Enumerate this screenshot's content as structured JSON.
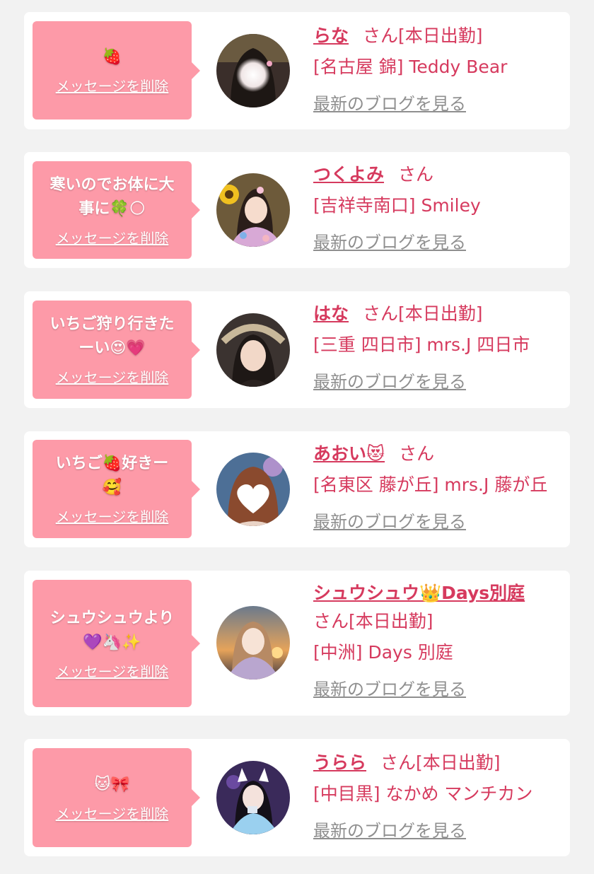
{
  "items": [
    {
      "message": "🍓",
      "delete_label": "メッセージを削除",
      "name": "らな",
      "suffix": "さん[本日出勤]",
      "shop": "[名古屋 錦] Teddy Bear",
      "blog_label": "最新のブログを見る"
    },
    {
      "message": "寒いのでお体に大\n事に🍀🌕",
      "delete_label": "メッセージを削除",
      "name": "つくよみ",
      "suffix": "さん",
      "shop": "[吉祥寺南口] Smiley",
      "blog_label": "最新のブログを見る"
    },
    {
      "message": "いちご狩り行きた\nーい😍💗",
      "delete_label": "メッセージを削除",
      "name": "はな",
      "suffix": "さん[本日出勤]",
      "shop": "[三重 四日市] mrs.J 四日市",
      "blog_label": "最新のブログを見る"
    },
    {
      "message": "いちご🍓好きー\n🥰",
      "delete_label": "メッセージを削除",
      "name": "あおい😻",
      "suffix": "さん",
      "shop": "[名東区 藤が丘] mrs.J 藤が丘",
      "blog_label": "最新のブログを見る"
    },
    {
      "message": "シュウシュウより\n💜🦄✨",
      "delete_label": "メッセージを削除",
      "name": "シュウシュウ👑Days別庭",
      "suffix": "さん[本日出勤]",
      "shop": "[中洲] Days 別庭",
      "blog_label": "最新のブログを見る"
    },
    {
      "message": "🐱🎀",
      "delete_label": "メッセージを削除",
      "name": "うらら",
      "suffix": "さん[本日出勤]",
      "shop": "[中目黒] なかめ マンチカン",
      "blog_label": "最新のブログを見る"
    }
  ]
}
